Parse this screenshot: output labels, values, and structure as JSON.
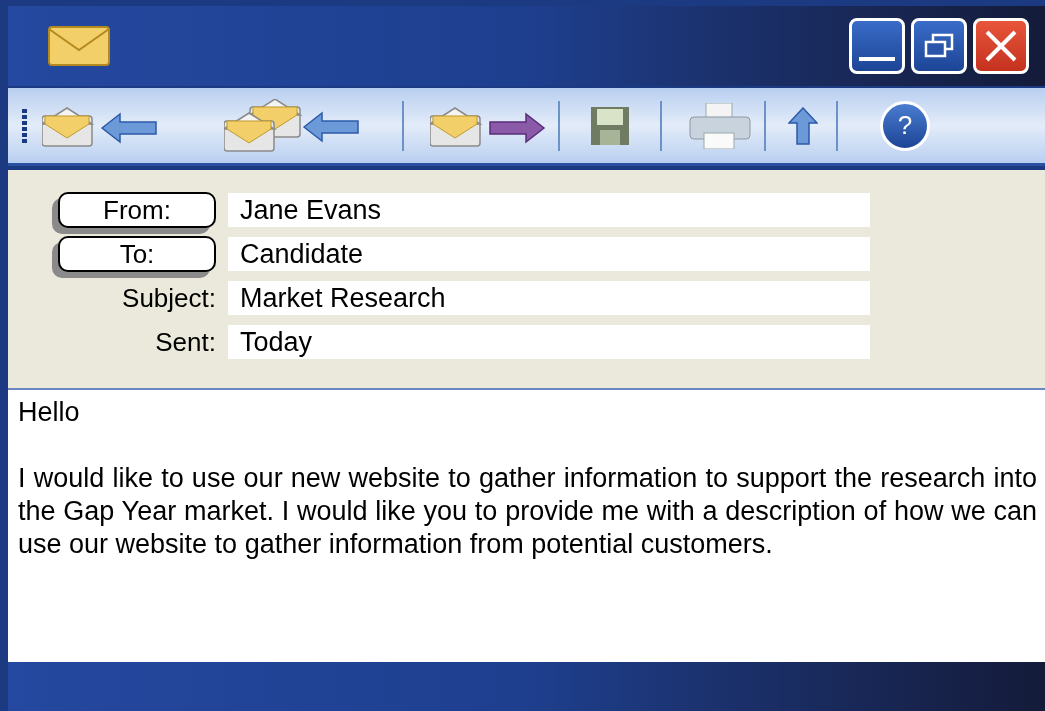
{
  "toolbar": {
    "help_label": "?"
  },
  "header": {
    "fields": [
      {
        "kind": "button",
        "label": "From:",
        "value": "Jane Evans"
      },
      {
        "kind": "button",
        "label": "To:",
        "value": "Candidate"
      },
      {
        "kind": "label",
        "label": "Subject:",
        "value": "Market Research"
      },
      {
        "kind": "label",
        "label": "Sent:",
        "value": "Today"
      }
    ]
  },
  "body": {
    "greeting": "Hello",
    "paragraph": "I would like to use our new website to gather information to support the research into the Gap Year market. I would like you to provide me with a description of how we can use our website to gather information from potential customers."
  }
}
